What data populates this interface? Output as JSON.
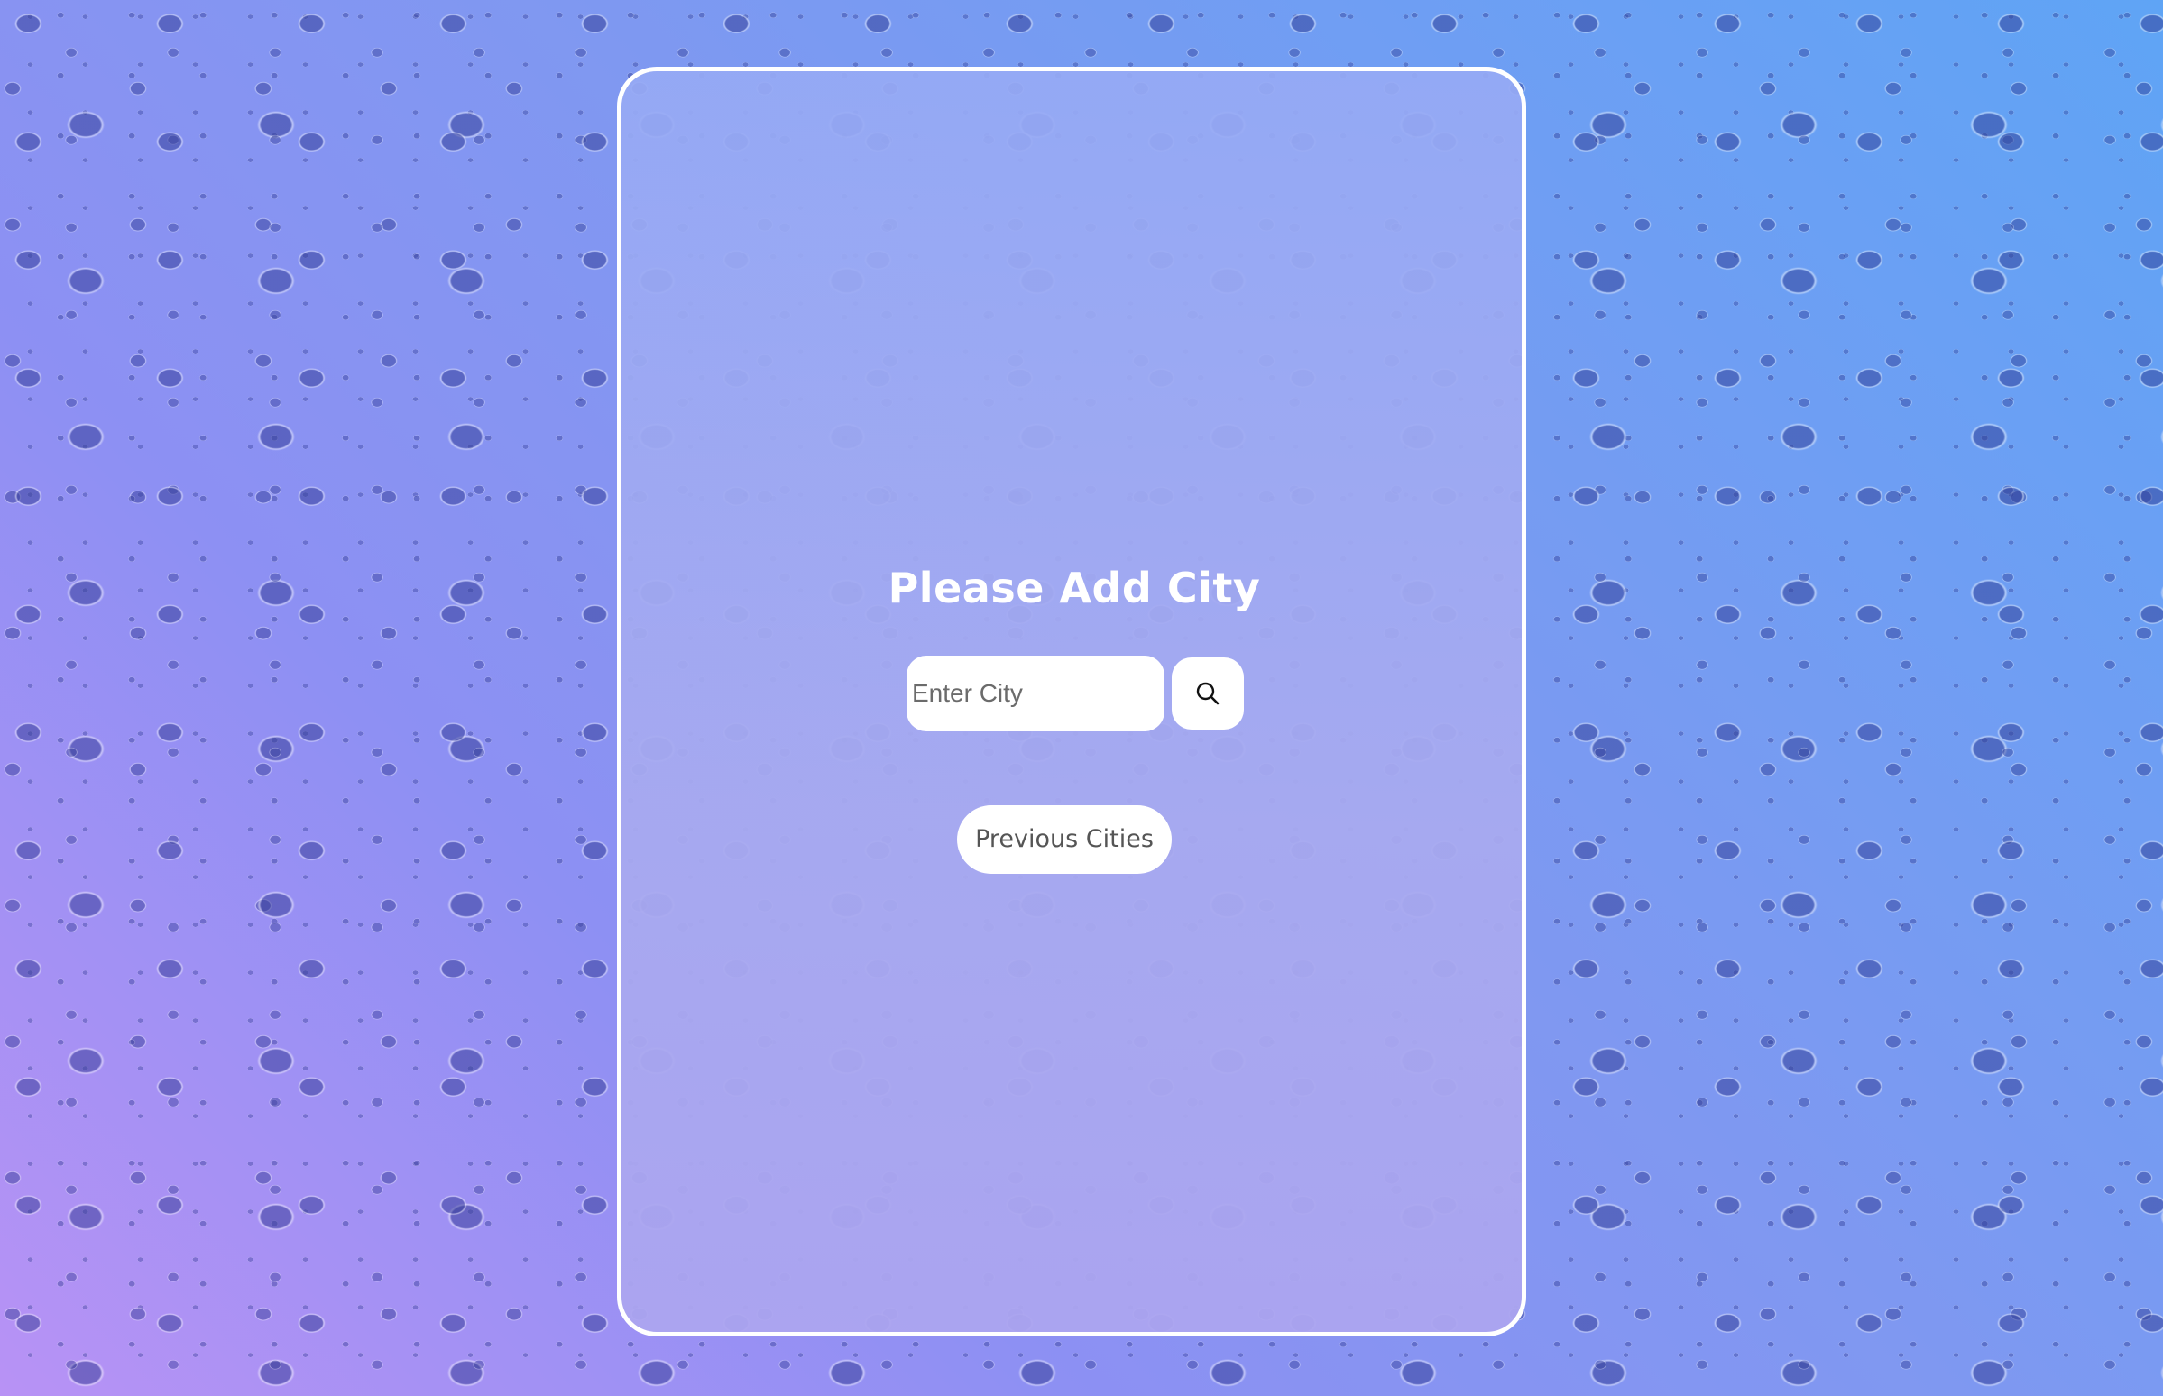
{
  "card": {
    "title": "Please Add City",
    "search": {
      "placeholder": "Enter City",
      "value": "",
      "icon": "search-icon"
    },
    "previous_cities_label": "Previous Cities"
  },
  "colors": {
    "card_border": "#ffffff",
    "title": "#ffffff",
    "button_bg": "#ffffff",
    "button_text": "#555555"
  }
}
